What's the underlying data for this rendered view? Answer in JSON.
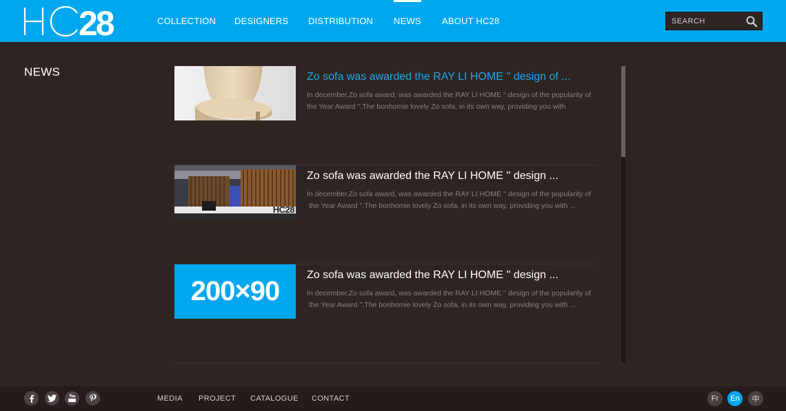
{
  "brand": {
    "logo_text": "HC28",
    "accent_color": "#00a7ee",
    "background_color": "#2e2522"
  },
  "nav": {
    "items": [
      {
        "label": "COLLECTION"
      },
      {
        "label": "DESIGNERS"
      },
      {
        "label": "DISTRIBUTION"
      },
      {
        "label": "NEWS",
        "active": true
      },
      {
        "label": "ABOUT HC28"
      }
    ]
  },
  "search": {
    "placeholder": "SEARCH",
    "icon": "search-icon"
  },
  "section": {
    "title": "NEWS"
  },
  "news": [
    {
      "title": "Zo sofa was awarded the RAY LI HOME '' design of ...",
      "desc_line1": "In december,Zo sofa award, was awarded the RAY LI HOME '' design of the popularity of",
      "desc_line2": "the Year Award ''.The bonhomie lovely Zo sofa, in its own way, providing you with",
      "thumb": "chair-photo"
    },
    {
      "title": "Zo sofa was awarded the RAY LI HOME '' design ...",
      "desc_line1": "In december,Zo sofa award, was awarded the RAY LI HOME '' design of the popularity of",
      "desc_line2": "the Year Award ''.The bonhomie lovely Zo sofa, in its own way, providing you with ...",
      "thumb": "exhibition-booth-photo",
      "thumb_text": "HC28"
    },
    {
      "title": "Zo sofa was awarded the RAY LI HOME '' design ...",
      "desc_line1": "In december,Zo sofa award, was awarded the RAY LI HOME '' design of the popularity of",
      "desc_line2": "the Year Award ''.The bonhomie lovely Zo sofa, in its own way, providing you with ...",
      "thumb": "placeholder-image",
      "thumb_text": "200×90"
    }
  ],
  "footer": {
    "social": [
      "facebook-icon",
      "twitter-icon",
      "youtube-icon",
      "pinterest-icon"
    ],
    "links": [
      {
        "label": "MEDIA"
      },
      {
        "label": "PROJECT"
      },
      {
        "label": "CATALOGUE"
      },
      {
        "label": "CONTACT"
      }
    ],
    "languages": [
      {
        "label": "Fr"
      },
      {
        "label": "En",
        "active": true
      },
      {
        "label": "中"
      }
    ]
  }
}
